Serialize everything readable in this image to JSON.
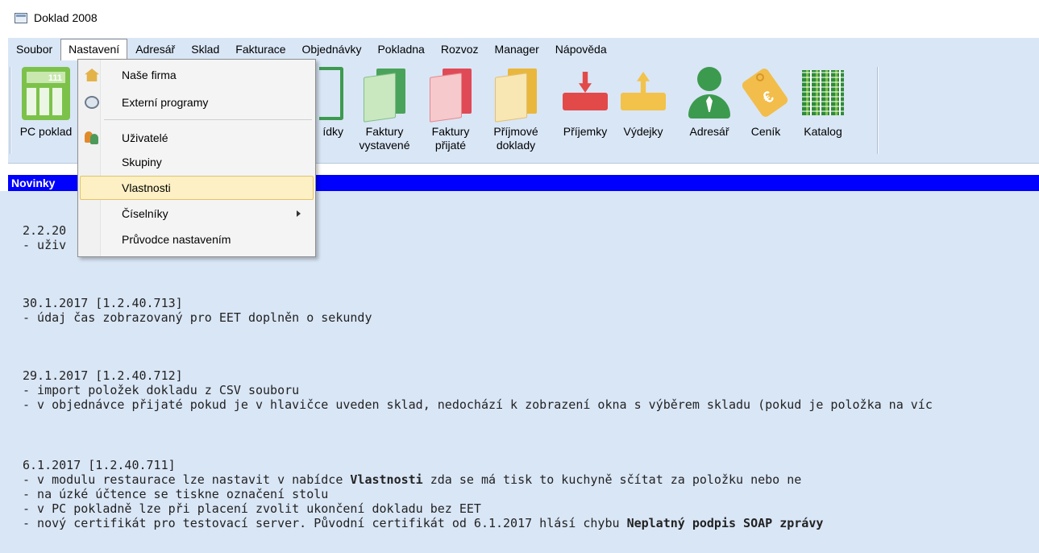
{
  "window": {
    "title": "Doklad 2008"
  },
  "menubar": {
    "items": [
      "Soubor",
      "Nastavení",
      "Adresář",
      "Sklad",
      "Fakturace",
      "Objednávky",
      "Pokladna",
      "Rozvoz",
      "Manager",
      "Nápověda"
    ],
    "open_item": "Nastavení"
  },
  "toolbar": {
    "pc_pokladna": "PC poklad",
    "nabidky": "ídky",
    "faktury_vystavene_1": "Faktury",
    "faktury_vystavene_2": "vystavené",
    "faktury_prijate_1": "Faktury",
    "faktury_prijate_2": "přijaté",
    "prijmove_doklady_1": "Příjmové",
    "prijmove_doklady_2": "doklady",
    "prijemky": "Příjemky",
    "vydejky": "Výdejky",
    "adresar": "Adresář",
    "cenik": "Ceník",
    "katalog": "Katalog",
    "calc_display": "111"
  },
  "news": {
    "header": "Novinky",
    "entries": [
      {
        "date": "2.2.20",
        "lines": [
          "- uživ"
        ]
      },
      {
        "date": "30.1.2017 [1.2.40.713]",
        "lines": [
          "- údaj čas zobrazovaný pro EET doplněn o sekundy"
        ]
      },
      {
        "date": "29.1.2017 [1.2.40.712]",
        "lines": [
          "- import položek dokladu z CSV souboru",
          "- v objednávce přijaté pokud je v hlavičce uveden sklad, nedochází k zobrazení okna s výběrem skladu (pokud je položka na víc"
        ]
      },
      {
        "date": "6.1.2017 [1.2.40.711]",
        "line1_pre": "- v modulu restaurace lze nastavit v nabídce ",
        "line1_bold": "Vlastnosti",
        "line1_post": " zda se má tisk to kuchyně sčítat za položku nebo ne",
        "line2": "- na úzké účtence se tiskne označení stolu",
        "line3": "- v PC pokladně lze při placení zvolit ukončení dokladu bez EET",
        "line4_pre": "- nový certifikát pro testovací server. Původní certifikát od 6.1.2017 hlásí chybu ",
        "line4_bold": "Neplatný podpis SOAP zprávy"
      }
    ]
  },
  "dropdown": {
    "items": [
      "Naše firma",
      "Externí programy",
      "Uživatelé",
      "Skupiny",
      "Vlastnosti",
      "Číselníky",
      "Průvodce nastavením"
    ],
    "hovered": "Vlastnosti"
  },
  "colors": {
    "chrome": "#d9e6f6",
    "news_header": "#0000ff",
    "hover": "#fcf0c4"
  }
}
